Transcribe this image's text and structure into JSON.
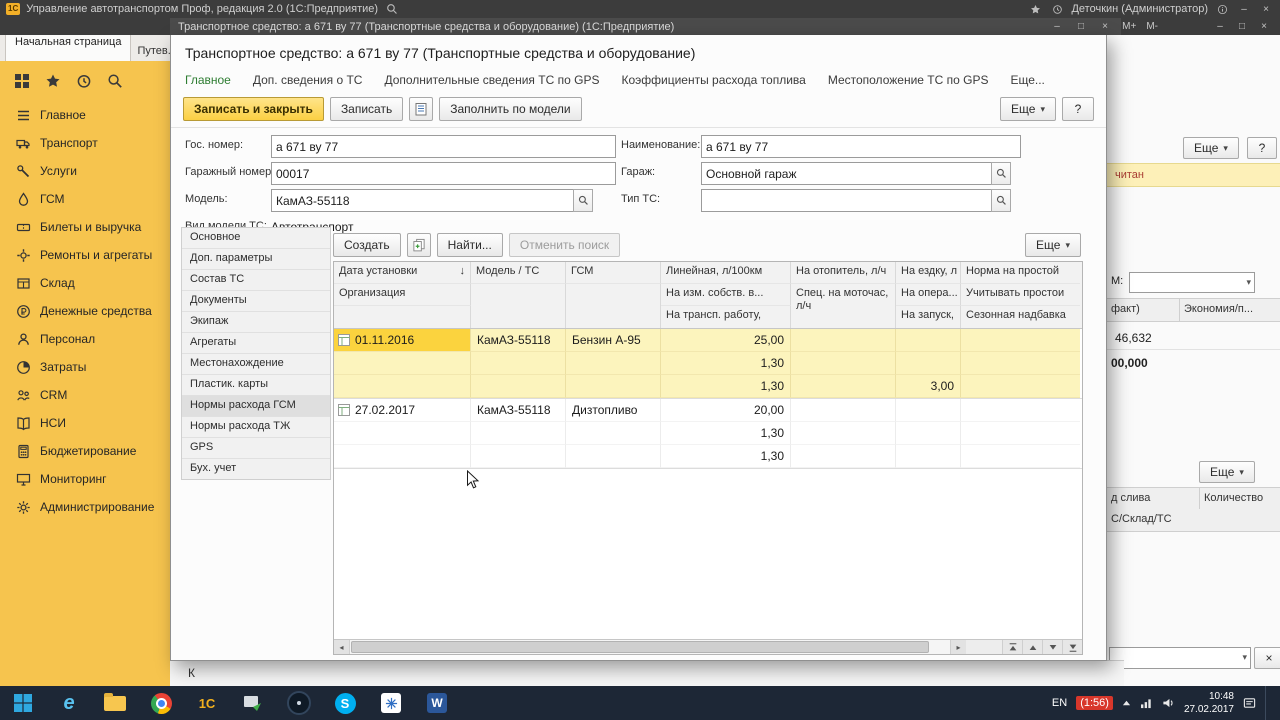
{
  "titlebar": {
    "app_title": "Управление автотранспортом Проф, редакция 2.0 (1С:Предприятие)",
    "user": "Деточкин (Администратор)",
    "memory_buttons": [
      "М",
      "М+",
      "М-"
    ]
  },
  "dialog_titlebar": {
    "title": "Транспортное средство: а 671 ву 77 (Транспортные средства и оборудование)  (1С:Предприятие)"
  },
  "tabs": {
    "tab1": "Начальная страница",
    "tab2": "Путев..."
  },
  "sidebar": {
    "items": [
      "Главное",
      "Транспорт",
      "Услуги",
      "ГСМ",
      "Билеты и выручка",
      "Ремонты и агрегаты",
      "Склад",
      "Денежные средства",
      "Персонал",
      "Затраты",
      "CRM",
      "НСИ",
      "Бюджетирование",
      "Мониторинг",
      "Администрирование"
    ]
  },
  "dialog": {
    "header": "Транспортное средство: а 671 ву 77 (Транспортные средства и оборудование)",
    "nav": [
      "Главное",
      "Доп. сведения о ТС",
      "Дополнительные сведения ТС по GPS",
      "Коэффициенты расхода топлива",
      "Местоположение ТС по GPS",
      "Еще..."
    ],
    "toolbar": {
      "save_close": "Записать и закрыть",
      "save": "Записать",
      "fill_by_model": "Заполнить по модели",
      "more": "Еще",
      "help": "?"
    },
    "form": {
      "gos_number_label": "Гос. номер:",
      "gos_number": "а 671 ву 77",
      "name_label": "Наименование:",
      "name": "а 671 ву 77",
      "garage_number_label": "Гаражный номер:",
      "garage_number": "00017",
      "garage_label": "Гараж:",
      "garage": "Основной гараж",
      "model_label": "Модель:",
      "model": "КамАЗ-55118",
      "type_label": "Тип ТС:",
      "type": "",
      "model_kind_label": "Вид модели ТС:",
      "model_kind": "Автотранспорт"
    },
    "sections": [
      "Основное",
      "Доп. параметры",
      "Состав ТС",
      "Документы",
      "Экипаж",
      "Агрегаты",
      "Местонахождение",
      "Пластик. карты",
      "Нормы расхода ГСМ",
      "Нормы расхода ТЖ",
      "GPS",
      "Бух. учет"
    ],
    "list_toolbar": {
      "create": "Создать",
      "find": "Найти...",
      "cancel_search": "Отменить поиск",
      "more": "Еще"
    },
    "table": {
      "sort_arrow": "↓",
      "header": {
        "c1l1": "Дата установки",
        "c1l2": "Организация",
        "c2l1": "Модель / ТС",
        "c3l1": "ГСМ",
        "c4l1": "Линейная, л/100км",
        "c4l2": "На изм. собств. в...",
        "c4l3": "На трансп. работу,",
        "c5l1": "На отопитель, л/ч",
        "c5l2": "Спец. на моточас, л/ч",
        "c6l1": "На ездку, л",
        "c6l2": "На опера...",
        "c6l3": "На запуск,",
        "c7l1": "Норма на простой",
        "c7l2": "Учитывать простои",
        "c7l3": "Сезонная надбавка"
      },
      "rows": [
        {
          "date": "01.11.2016",
          "model": "КамАЗ-55118",
          "fuel": "Бензин А-95",
          "linear": "25,00",
          "own_weight": "1,30",
          "transport_work": "1,30",
          "launch": "3,00"
        },
        {
          "date": "27.02.2017",
          "model": "КамАЗ-55118",
          "fuel": "Дизтопливо",
          "linear": "20,00",
          "own_weight": "1,30",
          "transport_work": "1,30",
          "launch": ""
        }
      ]
    }
  },
  "right_panel": {
    "more": "Еще",
    "help": "?",
    "strip_text": "читан",
    "m_label": "М:",
    "col_fact": "факт)",
    "col_econ": "Экономия/п...",
    "value1": "46,632",
    "value2": "00,000",
    "more2": "Еще",
    "col_sliv": "д слива",
    "col_qty": "Количество",
    "col_sklad": "С/Склад/ТС"
  },
  "bottom_strip": {
    "text": "К"
  },
  "taskbar": {
    "lang": "EN",
    "timer": "(1:56)",
    "time": "10:48",
    "date": "27.02.2017"
  }
}
